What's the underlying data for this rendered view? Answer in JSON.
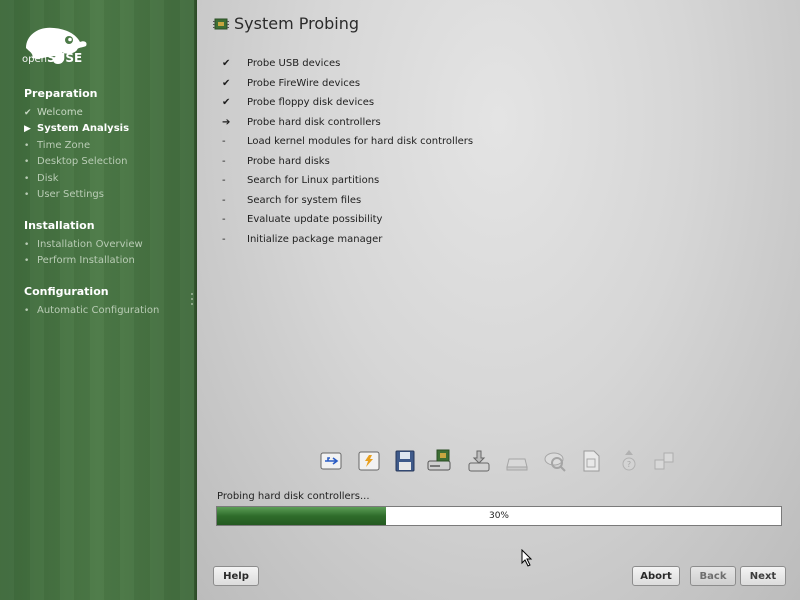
{
  "brand": {
    "light": "open",
    "bold": "SUSE"
  },
  "sidebar": {
    "sections": [
      {
        "title": "Preparation",
        "steps": [
          {
            "label": "Welcome",
            "state": "done"
          },
          {
            "label": "System Analysis",
            "state": "current"
          },
          {
            "label": "Time Zone",
            "state": "pending"
          },
          {
            "label": "Desktop Selection",
            "state": "pending"
          },
          {
            "label": "Disk",
            "state": "pending"
          },
          {
            "label": "User Settings",
            "state": "pending"
          }
        ]
      },
      {
        "title": "Installation",
        "steps": [
          {
            "label": "Installation Overview",
            "state": "pending"
          },
          {
            "label": "Perform Installation",
            "state": "pending"
          }
        ]
      },
      {
        "title": "Configuration",
        "steps": [
          {
            "label": "Automatic Configuration",
            "state": "pending"
          }
        ]
      }
    ]
  },
  "main": {
    "title": "System Probing",
    "tasks": [
      {
        "label": "Probe USB devices",
        "mark": "✔"
      },
      {
        "label": "Probe FireWire devices",
        "mark": "✔"
      },
      {
        "label": "Probe floppy disk devices",
        "mark": "✔"
      },
      {
        "label": "Probe hard disk controllers",
        "mark": "➔"
      },
      {
        "label": "Load kernel modules for hard disk controllers",
        "mark": "-"
      },
      {
        "label": "Probe hard disks",
        "mark": "-"
      },
      {
        "label": "Search for Linux partitions",
        "mark": "-"
      },
      {
        "label": "Search for system files",
        "mark": "-"
      },
      {
        "label": "Evaluate update possibility",
        "mark": "-"
      },
      {
        "label": "Initialize package manager",
        "mark": "-"
      }
    ],
    "hardware_icons": [
      "usb-icon",
      "firewire-icon",
      "floppy-icon",
      "disk-controller-icon",
      "kernel-module-icon",
      "hard-disk-icon",
      "partition-search-icon",
      "system-files-icon",
      "update-icon",
      "package-manager-icon"
    ],
    "progress": {
      "label": "Probing hard disk controllers...",
      "percent": 30,
      "text": "30%"
    }
  },
  "buttons": {
    "help": "Help",
    "abort": "Abort",
    "back": "Back",
    "next": "Next"
  },
  "colors": {
    "sidebar_green": "#4c7a47",
    "progress_green": "#2f6c2b"
  }
}
